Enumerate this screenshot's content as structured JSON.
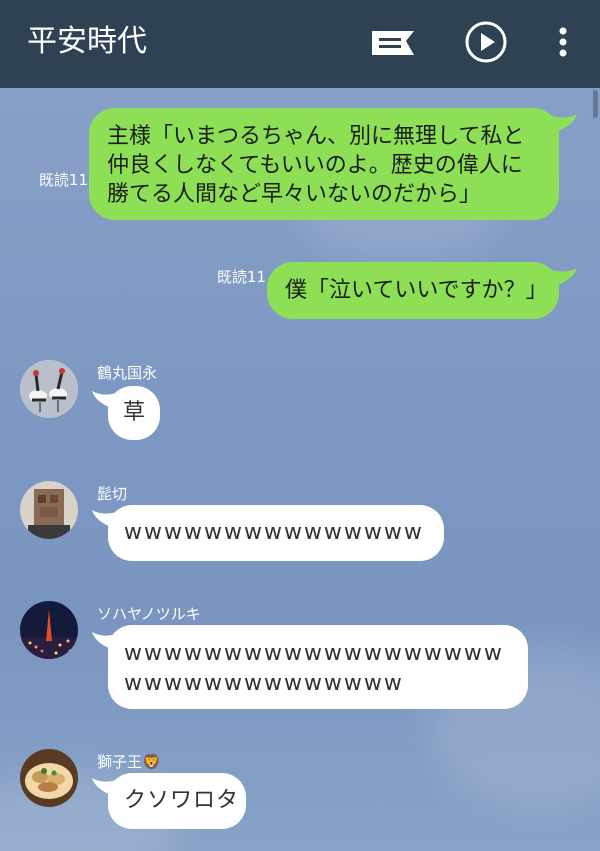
{
  "header": {
    "title": "平安時代",
    "icons": [
      "note-icon",
      "play-icon",
      "more-icon"
    ]
  },
  "messages": [
    {
      "type": "outgoing",
      "read": "既読11",
      "text": "主様「いまつるちゃん、別に無理して私と仲良くしなくてもいいのよ。歴史の偉人に勝てる人間など早々いないのだから」"
    },
    {
      "type": "outgoing",
      "read": "既読11",
      "text": "僕「泣いていいですか？」"
    },
    {
      "type": "incoming",
      "sender": "鶴丸国永",
      "text": "草"
    },
    {
      "type": "incoming",
      "sender": "髭切",
      "text": "wwwwwwwwwwwwwww"
    },
    {
      "type": "incoming",
      "sender": "ソハヤノツルキ",
      "text": "wwwwwwwwwwwwwwwwwwwwwwwwwwwwwwwww"
    },
    {
      "type": "incoming",
      "sender": "獅子王",
      "sender_emoji": "🦁",
      "text": "クソワロタ"
    }
  ],
  "colors": {
    "header_bg": "#2f4254",
    "chat_bg": "#7b96bf",
    "outgoing_bubble": "#8de055",
    "incoming_bubble": "#ffffff"
  }
}
